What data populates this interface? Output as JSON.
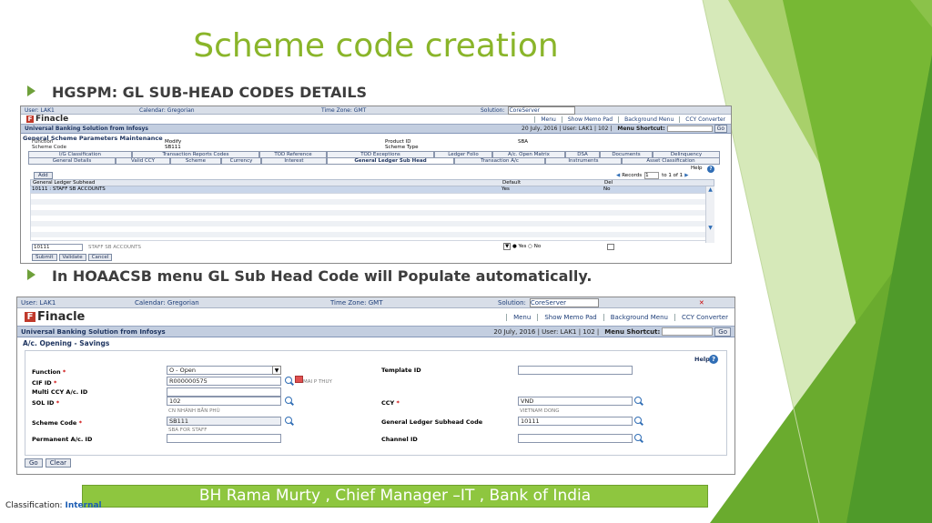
{
  "slide": {
    "title": "Scheme code creation",
    "bullet1": "HGSPM: GL SUB-HEAD CODES DETAILS",
    "bullet2": "In HOAACSB menu GL Sub Head Code will Populate automatically.",
    "footer": "BH Rama Murty , Chief Manager –IT , Bank of India",
    "classification_label": "Classification:",
    "classification_value": "Internal",
    "colors": {
      "accent": "#8ab52a",
      "footer_bg": "#8ec63f",
      "finacle_red": "#c0392b"
    }
  },
  "shot1": {
    "user": "User: LAK1",
    "calendar": "Calendar: Gregorian",
    "timezone": "Time Zone: GMT",
    "solution_label": "Solution:",
    "solution_value": "CoreServer",
    "logo": "Finacle",
    "menus": [
      "Menu",
      "Show Memo Pad",
      "Background Menu",
      "CCY Converter"
    ],
    "ubs": "Universal Banking Solution from Infosys",
    "date_info": "20 July, 2016 | User: LAK1 | 102 |",
    "shortcut_label": "Menu Shortcut:",
    "go": "Go",
    "page_title": "General Scheme Parameters Maintenance",
    "function_label": "Function",
    "function_value": "Modify",
    "scheme_code_label": "Scheme Code",
    "scheme_code_value": "SB111",
    "product_id_label": "Product ID",
    "product_id_value": "",
    "scheme_type_label": "Scheme Type",
    "scheme_type_value": "SBA",
    "tabs_row1": [
      "I/G Classification",
      "Transaction Reports Codes",
      "TOD Reference",
      "TOD Exceptions",
      "Ledger Folio",
      "A/c. Open Matrix",
      "DSA",
      "Documents",
      "Delinquency"
    ],
    "tabs_row2": [
      "General Details",
      "Valid CCY",
      "Scheme",
      "Currency",
      "Interest",
      "General Ledger Sub Head",
      "Transaction A/c",
      "Instruments",
      "Asset Classification"
    ],
    "add": "Add",
    "records": "Records",
    "record_from": "1",
    "record_to": "to 1 of 1",
    "help": "Help",
    "table_headers": [
      "General Ledger Subhead",
      "Default",
      "Del"
    ],
    "row": {
      "subhead": "10111 : STAFF SB ACCOUNTS",
      "default": "Yes",
      "del": "No"
    },
    "bottom_code": "10111",
    "bottom_desc": "STAFF SB ACCOUNTS",
    "yes": "Yes",
    "no": "No",
    "buttons": [
      "Submit",
      "Validate",
      "Cancel"
    ]
  },
  "shot2": {
    "user": "User: LAK1",
    "calendar": "Calendar: Gregorian",
    "timezone": "Time Zone: GMT",
    "solution_label": "Solution:",
    "solution_value": "CoreServer",
    "logo": "Finacle",
    "menus": [
      "Menu",
      "Show Memo Pad",
      "Background Menu",
      "CCY Converter"
    ],
    "ubs": "Universal Banking Solution from Infosys",
    "date_info": "20 July, 2016 | User: LAK1 | 102 |",
    "shortcut_label": "Menu Shortcut:",
    "go": "Go",
    "page_title": "A/c. Opening - Savings",
    "help": "Help",
    "function_label": "Function",
    "function_value": "O - Open",
    "template_label": "Template ID",
    "template_value": "",
    "cif_label": "CIF ID",
    "cif_value": "R000000575",
    "cif_hint": "MAI P THUY",
    "multiccy_label": "Multi CCY A/c. ID",
    "multiccy_value": "",
    "sol_label": "SOL ID",
    "sol_value": "102",
    "sol_hint": "CN NHÁNH BẮN PHÚ",
    "ccy_label": "CCY",
    "ccy_value": "VND",
    "ccy_hint": "VIETNAM DONG",
    "scheme_label": "Scheme Code",
    "scheme_value": "SB111",
    "scheme_hint": "SBA FOR STAFF",
    "gl_label": "General Ledger Subhead Code",
    "gl_value": "10111",
    "perm_label": "Permanent A/c. ID",
    "perm_value": "",
    "channel_label": "Channel ID",
    "channel_value": "",
    "buttons": [
      "Go",
      "Clear"
    ]
  }
}
